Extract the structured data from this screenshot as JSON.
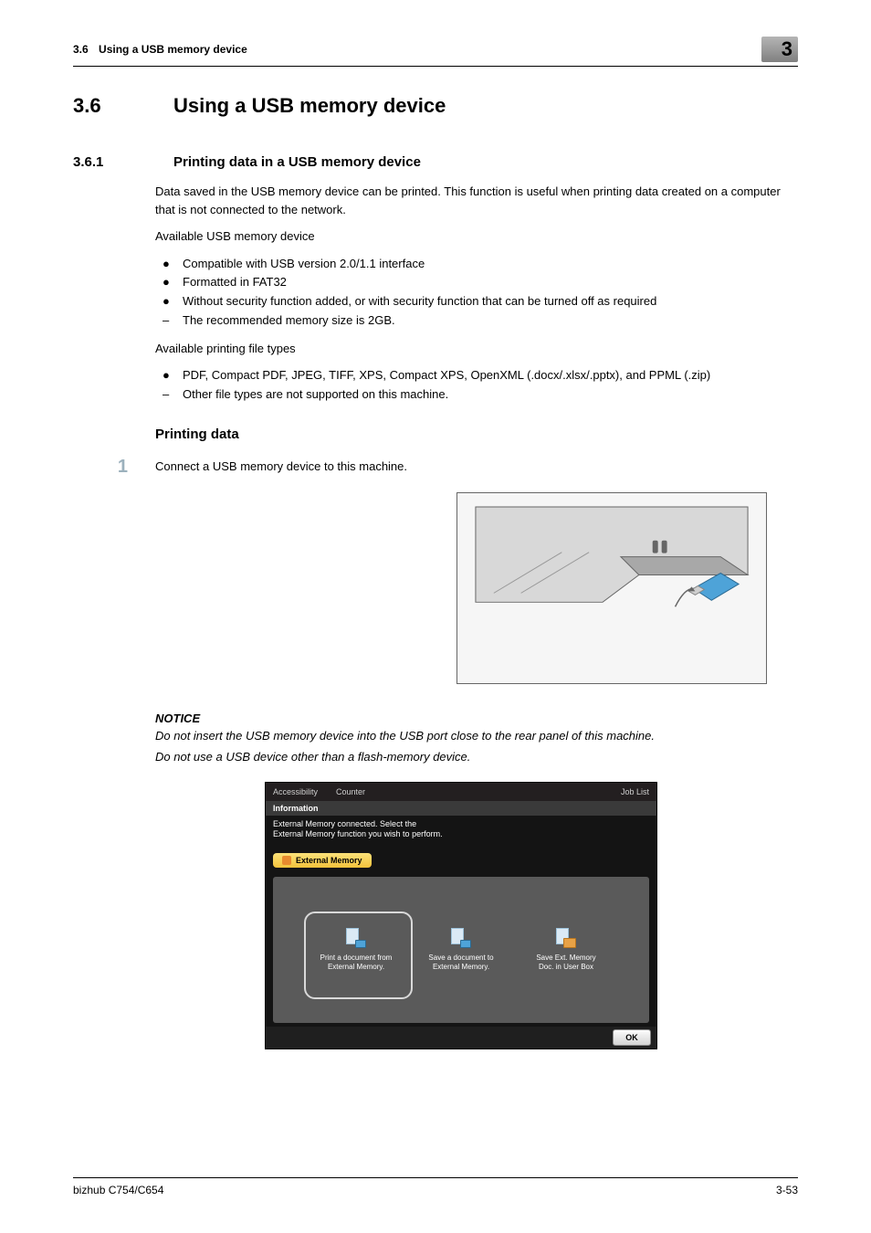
{
  "header": {
    "section_num": "3.6",
    "section_title": "Using a USB memory device",
    "chapter_num": "3"
  },
  "h1": {
    "num": "3.6",
    "title": "Using a USB memory device"
  },
  "h2": {
    "num": "3.6.1",
    "title": "Printing data in a USB memory device"
  },
  "para1": "Data saved in the USB memory device can be printed. This function is useful when printing data created on a computer that is not connected to the network.",
  "para2": "Available USB memory device",
  "list1": [
    {
      "bullet": "●",
      "text": "Compatible with USB version 2.0/1.1 interface"
    },
    {
      "bullet": "●",
      "text": "Formatted in FAT32"
    },
    {
      "bullet": "●",
      "text": "Without security function added, or with security function that can be turned off as required"
    },
    {
      "bullet": "–",
      "text": "The recommended memory size is 2GB."
    }
  ],
  "para3": "Available printing file types",
  "list2": [
    {
      "bullet": "●",
      "text": "PDF, Compact PDF, JPEG, TIFF, XPS, Compact XPS, OpenXML (.docx/.xlsx/.pptx), and PPML (.zip)"
    },
    {
      "bullet": "–",
      "text": "Other file types are not supported on this machine."
    }
  ],
  "h3": "Printing data",
  "step1": {
    "num": "1",
    "text": "Connect a USB memory device to this machine."
  },
  "notice": {
    "title": "NOTICE",
    "line1": "Do not insert the USB memory device into the USB port close to the rear panel of this machine.",
    "line2": "Do not use a USB device other than a flash-memory device."
  },
  "ui": {
    "top": {
      "accessibility": "Accessibility",
      "counter": "Counter",
      "joblist": "Job List"
    },
    "info_label": "Information",
    "msg_line1": "External Memory connected. Select the",
    "msg_line2": "External Memory function you wish to perform.",
    "tab": "External Memory",
    "tiles": [
      {
        "line1": "Print a document from",
        "line2": "External Memory."
      },
      {
        "line1": "Save a document to",
        "line2": "External Memory."
      },
      {
        "line1": "Save Ext. Memory",
        "line2": "Doc. in User Box"
      }
    ],
    "ok": "OK"
  },
  "footer": {
    "left": "bizhub C754/C654",
    "right": "3-53"
  }
}
